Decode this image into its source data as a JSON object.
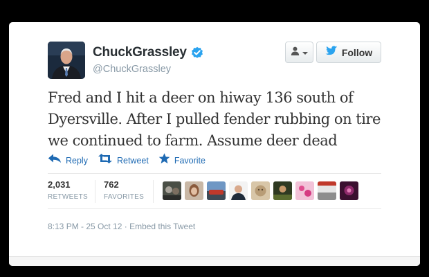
{
  "profile": {
    "fullname": "ChuckGrassley",
    "handle": "@ChuckGrassley",
    "verified": true,
    "avatar_icon": "profile-photo"
  },
  "buttons": {
    "user_dropdown_icon": "person-dropdown-icon",
    "follow_label": "Follow"
  },
  "tweet": {
    "text": "Fred and I hit a deer on hiway 136 south of Dyersville. After I pulled fender rubbing on tire we continued to farm. Assume deer dead"
  },
  "actions": [
    {
      "label": "Reply",
      "icon": "reply-arrow-icon"
    },
    {
      "label": "Retweet",
      "icon": "retweet-icon"
    },
    {
      "label": "Favorite",
      "icon": "star-icon"
    }
  ],
  "stats": {
    "retweets_count": "2,031",
    "retweets_label": "RETWEETS",
    "favorites_count": "762",
    "favorites_label": "FAVORITES"
  },
  "faces_count": 9,
  "meta": {
    "timestamp": "8:13 PM - 25 Oct 12",
    "separator": "·",
    "embed_label": "Embed this Tweet"
  },
  "colors": {
    "link": "#1e6ab3",
    "verified": "#2aa3ef",
    "muted": "#8899a6",
    "text": "#333333"
  }
}
